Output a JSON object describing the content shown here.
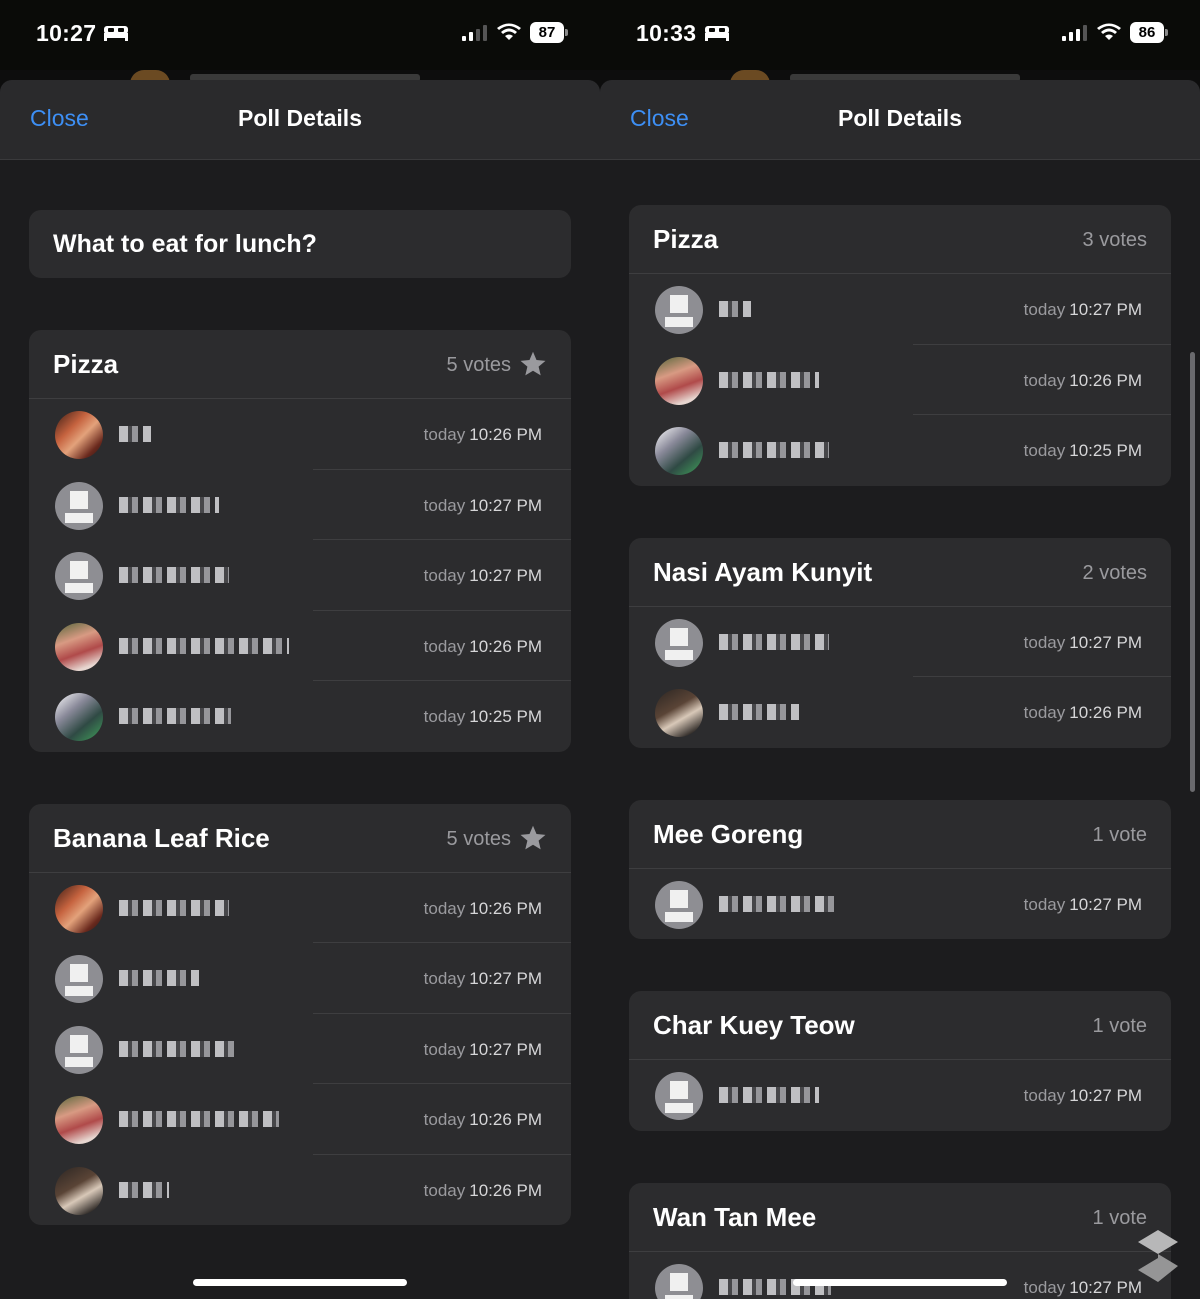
{
  "left": {
    "status": {
      "time": "10:27",
      "battery": "87"
    },
    "nav": {
      "close": "Close",
      "title": "Poll Details"
    },
    "question": "What to eat for lunch?",
    "options": [
      {
        "name": "Pizza",
        "votes": "5 votes",
        "winner": true,
        "voters": [
          {
            "avatar": "photo-a",
            "day": "today",
            "time": "10:26 PM"
          },
          {
            "avatar": "placeholder",
            "day": "today",
            "time": "10:27 PM"
          },
          {
            "avatar": "placeholder",
            "day": "today",
            "time": "10:27 PM"
          },
          {
            "avatar": "photo-b",
            "day": "today",
            "time": "10:26 PM"
          },
          {
            "avatar": "photo-c",
            "day": "today",
            "time": "10:25 PM"
          }
        ]
      },
      {
        "name": "Banana Leaf Rice",
        "votes": "5 votes",
        "winner": true,
        "voters": [
          {
            "avatar": "photo-a",
            "day": "today",
            "time": "10:26 PM"
          },
          {
            "avatar": "placeholder",
            "day": "today",
            "time": "10:27 PM"
          },
          {
            "avatar": "placeholder",
            "day": "today",
            "time": "10:27 PM"
          },
          {
            "avatar": "photo-b",
            "day": "today",
            "time": "10:26 PM"
          },
          {
            "avatar": "photo-d",
            "day": "today",
            "time": "10:26 PM"
          }
        ]
      }
    ]
  },
  "right": {
    "status": {
      "time": "10:33",
      "battery": "86"
    },
    "nav": {
      "close": "Close",
      "title": "Poll Details"
    },
    "options": [
      {
        "name": "Pizza",
        "votes": "3 votes",
        "voters": [
          {
            "avatar": "placeholder",
            "day": "today",
            "time": "10:27 PM"
          },
          {
            "avatar": "photo-b",
            "day": "today",
            "time": "10:26 PM"
          },
          {
            "avatar": "photo-c",
            "day": "today",
            "time": "10:25 PM"
          }
        ]
      },
      {
        "name": "Nasi Ayam Kunyit",
        "votes": "2 votes",
        "voters": [
          {
            "avatar": "placeholder",
            "day": "today",
            "time": "10:27 PM"
          },
          {
            "avatar": "photo-d",
            "day": "today",
            "time": "10:26 PM"
          }
        ]
      },
      {
        "name": "Mee Goreng",
        "votes": "1 vote",
        "voters": [
          {
            "avatar": "placeholder",
            "day": "today",
            "time": "10:27 PM"
          }
        ]
      },
      {
        "name": "Char Kuey Teow",
        "votes": "1 vote",
        "voters": [
          {
            "avatar": "placeholder",
            "day": "today",
            "time": "10:27 PM"
          }
        ]
      },
      {
        "name": "Wan Tan Mee",
        "votes": "1 vote",
        "voters": [
          {
            "avatar": "placeholder",
            "day": "today",
            "time": "10:27 PM"
          }
        ]
      }
    ]
  }
}
